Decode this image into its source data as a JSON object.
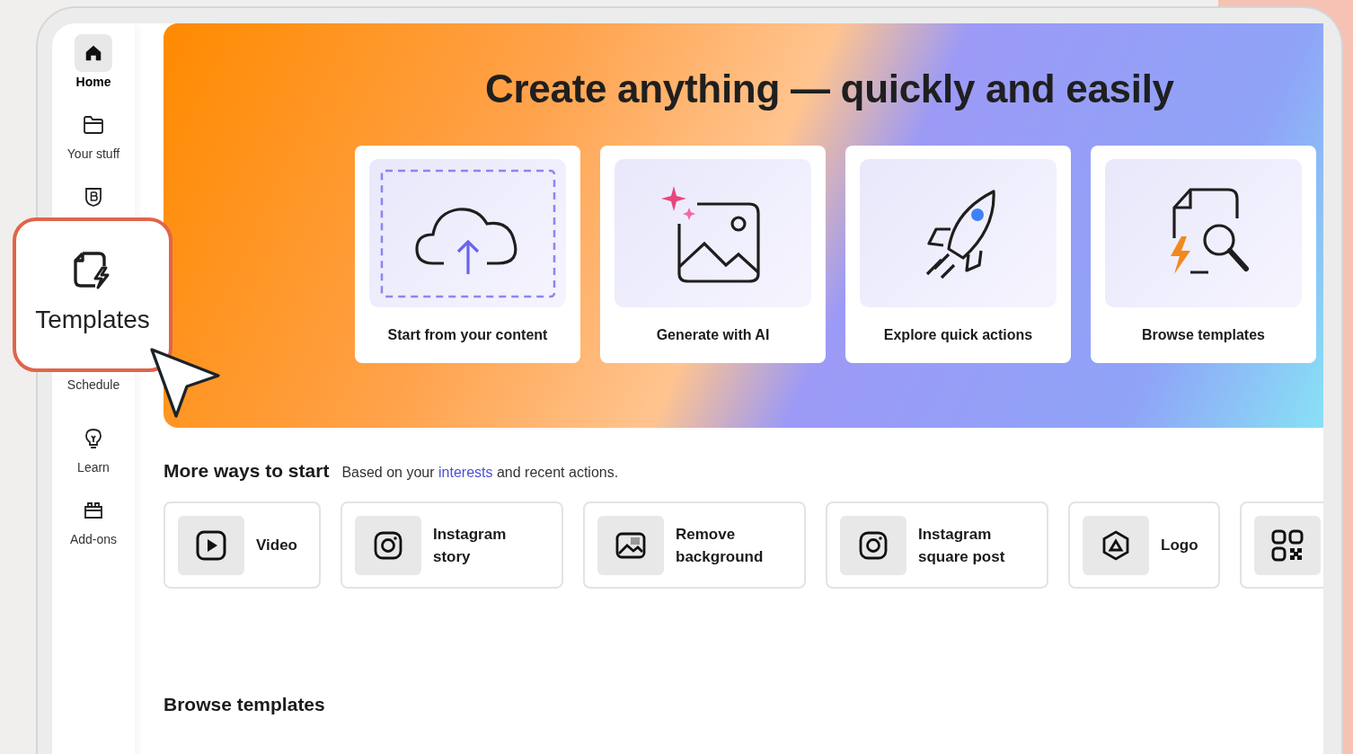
{
  "sidebar": {
    "items": [
      {
        "kind": "home",
        "label": "Home",
        "selected": true
      },
      {
        "kind": "folder",
        "label": "Your stuff",
        "selected": false
      },
      {
        "kind": "brand",
        "selected": false
      },
      {
        "kind": "schedule",
        "label": "Schedule",
        "selected": false
      },
      {
        "kind": "learn",
        "label": "Learn",
        "selected": false
      },
      {
        "kind": "addons",
        "label": "Add-ons",
        "selected": false
      }
    ]
  },
  "callout": {
    "label": "Templates"
  },
  "hero": {
    "title": "Create anything — quickly and easily",
    "cards": [
      {
        "kind": "upload",
        "label": "Start from your content"
      },
      {
        "kind": "ai",
        "label": "Generate with AI"
      },
      {
        "kind": "rocket",
        "label": "Explore quick actions"
      },
      {
        "kind": "templates",
        "label": "Browse templates"
      }
    ]
  },
  "more_ways": {
    "title": "More ways to start",
    "subtitle": {
      "before": "Based on your",
      "link": "interests",
      "after": "and recent actions."
    },
    "items": [
      {
        "kind": "video",
        "label": "Video"
      },
      {
        "kind": "instagram",
        "label": "Instagram story"
      },
      {
        "kind": "image",
        "label": "Remove background"
      },
      {
        "kind": "instagram",
        "label": "Instagram square post"
      },
      {
        "kind": "logo",
        "label": "Logo"
      },
      {
        "kind": "qr"
      }
    ]
  },
  "browse": {
    "title": "Browse templates"
  }
}
